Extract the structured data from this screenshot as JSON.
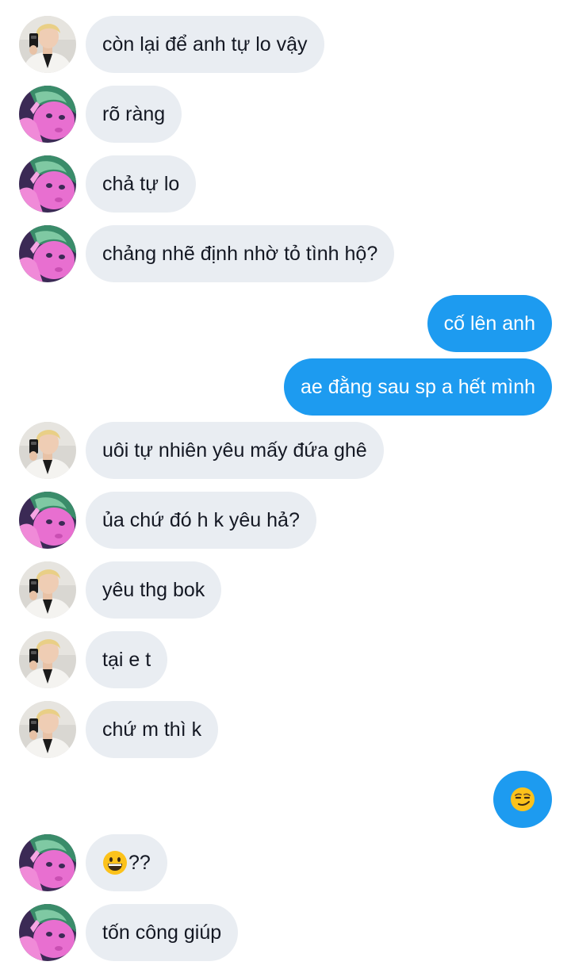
{
  "conversation": {
    "messages": [
      {
        "sender": "other",
        "avatar": "blonde",
        "text": "còn lại để anh tự lo vậy"
      },
      {
        "sender": "other",
        "avatar": "pink",
        "text": "rõ ràng"
      },
      {
        "sender": "other",
        "avatar": "pink",
        "text": "chả tự lo"
      },
      {
        "sender": "other",
        "avatar": "pink",
        "text": "chảng nhẽ định nhờ tỏ tình hộ?"
      },
      {
        "sender": "self",
        "text": "cố lên anh"
      },
      {
        "sender": "self",
        "text": "ae đằng sau sp a hết mình"
      },
      {
        "sender": "other",
        "avatar": "blonde",
        "text": "uôi tự nhiên yêu mấy đứa ghê"
      },
      {
        "sender": "other",
        "avatar": "pink",
        "text": "ủa chứ đó h k yêu hả?"
      },
      {
        "sender": "other",
        "avatar": "blonde",
        "text": "yêu thg bok"
      },
      {
        "sender": "other",
        "avatar": "blonde",
        "text": "tại e t"
      },
      {
        "sender": "other",
        "avatar": "blonde",
        "text": "chứ m thì k"
      },
      {
        "sender": "self",
        "emoji": "smirking-face"
      },
      {
        "sender": "other",
        "avatar": "pink",
        "emoji": "grinning-face",
        "text": "??"
      },
      {
        "sender": "other",
        "avatar": "pink",
        "text": "tốn công giúp"
      }
    ]
  },
  "colors": {
    "incoming_bubble": "#e9edf2",
    "outgoing_bubble": "#1d9bf0",
    "text_dark": "#141823",
    "text_light": "#ffffff"
  }
}
